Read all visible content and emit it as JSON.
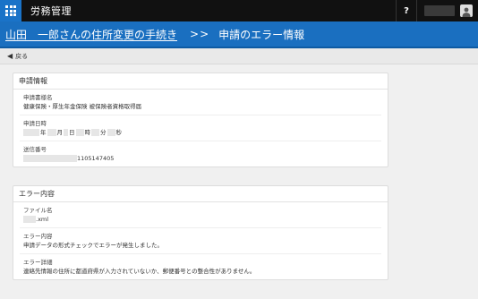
{
  "app": {
    "title": "労務管理",
    "help_label": "?"
  },
  "header": {
    "breadcrumb_link": "山田　一郎さんの住所変更の手続き",
    "separator": ">>",
    "page_title": "申請のエラー情報"
  },
  "back": {
    "label": "戻る"
  },
  "application_info": {
    "title": "申請情報",
    "form_name_label": "申請書様名",
    "form_name_value": "健康保険・厚生年金保険 被保険者資格取得届",
    "datetime_label": "申請日時",
    "datetime_units": {
      "year": "年",
      "month": "月",
      "day": "日",
      "hour": "時",
      "minute": "分",
      "second": "秒"
    },
    "send_number_label": "送信番号",
    "send_number_value": "1105147405"
  },
  "error_info": {
    "title": "エラー内容",
    "file_name_label": "ファイル名",
    "file_name_value": ".xml",
    "error_content_label": "エラー内容",
    "error_content_value": "申請データの形式チェックでエラーが発生しました。",
    "error_detail_label": "エラー詳細",
    "error_detail_value": "連絡先情報の住所に都道府県が入力されていないか、郵便番号との整合性がありません。"
  }
}
